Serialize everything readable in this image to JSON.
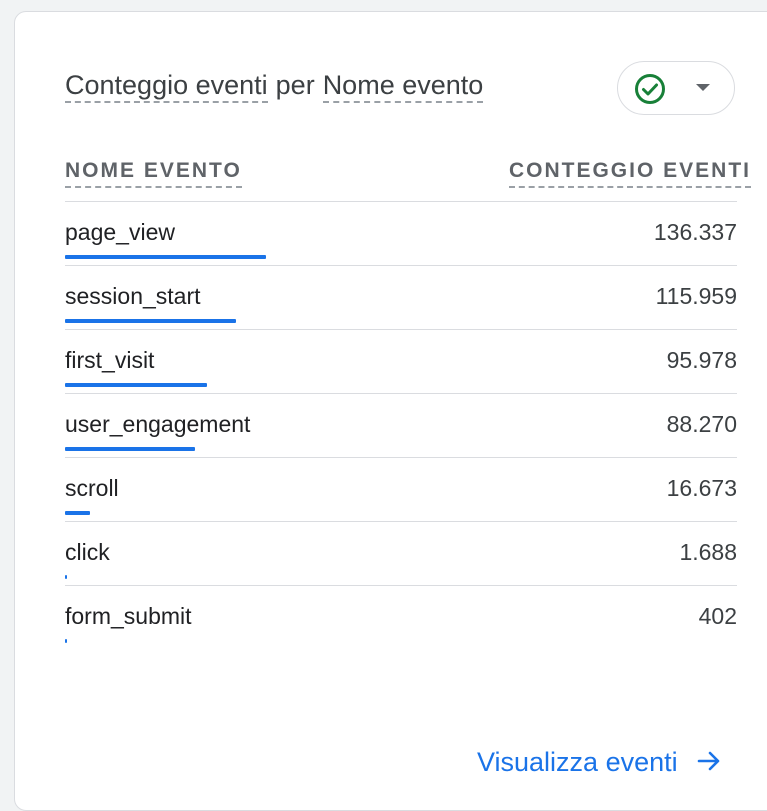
{
  "card": {
    "title_dimension_1": "Conteggio eventi",
    "title_connector": "per",
    "title_dimension_2": "Nome evento",
    "status_icon": "check-circle-icon",
    "status_color": "#188038"
  },
  "table": {
    "columns": [
      "NOME EVENTO",
      "CONTEGGIO EVENTI"
    ],
    "rows": [
      {
        "name": "page_view",
        "count": "136.337",
        "value": 136337
      },
      {
        "name": "session_start",
        "count": "115.959",
        "value": 115959
      },
      {
        "name": "first_visit",
        "count": "95.978",
        "value": 95978
      },
      {
        "name": "user_engagement",
        "count": "88.270",
        "value": 88270
      },
      {
        "name": "scroll",
        "count": "16.673",
        "value": 16673
      },
      {
        "name": "click",
        "count": "1.688",
        "value": 1688
      },
      {
        "name": "form_submit",
        "count": "402",
        "value": 402
      }
    ],
    "bar_color": "#1a73e8",
    "bar_max_fraction": 0.3
  },
  "footer": {
    "link_label": "Visualizza eventi",
    "link_icon": "arrow-right-icon"
  }
}
